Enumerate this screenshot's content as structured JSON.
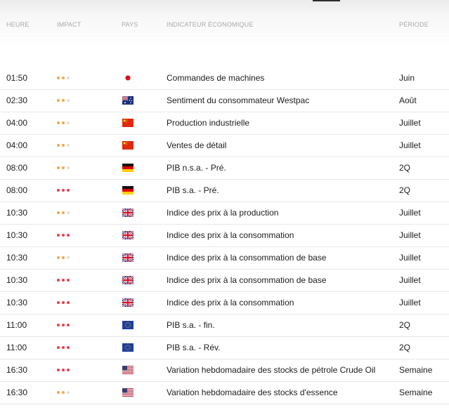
{
  "header": {
    "time": "HEURE",
    "impact": "IMPACT",
    "country": "PAYS",
    "indicator": "INDICATEUR ÉCONOMIQUE",
    "period": "PÉRIODE"
  },
  "colors": {
    "medium": "#f2a64b",
    "high": "#e8404a",
    "empty": "#dedede"
  },
  "rows": [
    {
      "time": "01:50",
      "impact": "medium",
      "country_flag": "japan-flag-icon",
      "indicator": "Commandes de machines",
      "period": "Juin"
    },
    {
      "time": "02:30",
      "impact": "medium",
      "country_flag": "australia-flag-icon",
      "indicator": "Sentiment du consommateur Westpac",
      "period": "Août"
    },
    {
      "time": "04:00",
      "impact": "medium",
      "country_flag": "china-flag-icon",
      "indicator": "Production industrielle",
      "period": "Juillet"
    },
    {
      "time": "04:00",
      "impact": "medium",
      "country_flag": "china-flag-icon",
      "indicator": "Ventes de détail",
      "period": "Juillet"
    },
    {
      "time": "08:00",
      "impact": "medium",
      "country_flag": "germany-flag-icon",
      "indicator": "PIB n.s.a. - Pré.",
      "period": "2Q"
    },
    {
      "time": "08:00",
      "impact": "high",
      "country_flag": "germany-flag-icon",
      "indicator": "PIB s.a. - Pré.",
      "period": "2Q"
    },
    {
      "time": "10:30",
      "impact": "medium",
      "country_flag": "uk-flag-icon",
      "indicator": "Indice des prix à la production",
      "period": "Juillet"
    },
    {
      "time": "10:30",
      "impact": "high",
      "country_flag": "uk-flag-icon",
      "indicator": "Indice des prix à la consommation",
      "period": "Juillet"
    },
    {
      "time": "10:30",
      "impact": "medium",
      "country_flag": "uk-flag-icon",
      "indicator": "Indice des prix à la consommation de base",
      "period": "Juillet"
    },
    {
      "time": "10:30",
      "impact": "high",
      "country_flag": "uk-flag-icon",
      "indicator": "Indice des prix à la consommation de base",
      "period": "Juillet"
    },
    {
      "time": "10:30",
      "impact": "high",
      "country_flag": "uk-flag-icon",
      "indicator": "Indice des prix à la consommation",
      "period": "Juillet"
    },
    {
      "time": "11:00",
      "impact": "high",
      "country_flag": "eu-flag-icon",
      "indicator": "PIB s.a. - fin.",
      "period": "2Q"
    },
    {
      "time": "11:00",
      "impact": "high",
      "country_flag": "eu-flag-icon",
      "indicator": "PIB s.a. - Rév.",
      "period": "2Q"
    },
    {
      "time": "16:30",
      "impact": "high",
      "country_flag": "usa-flag-icon",
      "indicator": "Variation hebdomadaire des stocks de pétrole Crude Oil",
      "period": "Semaine"
    },
    {
      "time": "16:30",
      "impact": "medium",
      "country_flag": "usa-flag-icon",
      "indicator": "Variation hebdomadaire des stocks d'essence",
      "period": "Semaine"
    }
  ]
}
